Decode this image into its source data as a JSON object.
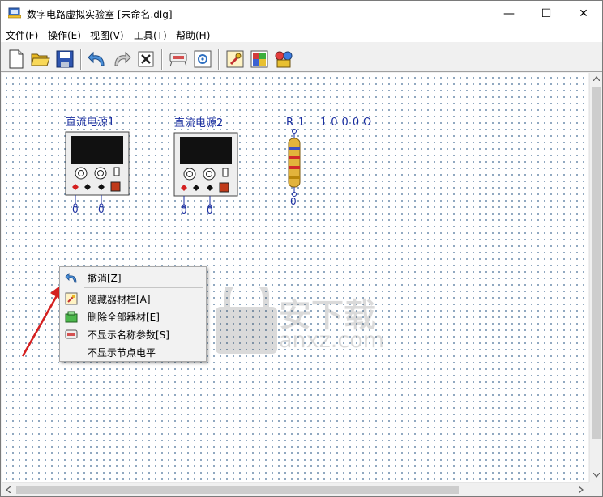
{
  "window": {
    "title": "数字电路虚拟实验室 [未命名.dlg]",
    "minimize_glyph": "—",
    "maximize_glyph": "☐",
    "close_glyph": "✕"
  },
  "menu": [
    "文件(F)",
    "操作(E)",
    "视图(V)",
    "工具(T)",
    "帮助(H)"
  ],
  "toolbar": {
    "buttons": [
      "new-file-icon",
      "open-folder-icon",
      "save-icon",
      "undo-icon",
      "redo-icon",
      "delete-icon",
      "component-icon",
      "settings-icon",
      "tool-wrench-icon",
      "palette-icon",
      "parts-library-icon"
    ]
  },
  "components": {
    "psu1": {
      "label": "直流电源1",
      "node_left": "0",
      "node_right": "0"
    },
    "psu2": {
      "label": "直流电源2",
      "node_left": "0",
      "node_right": "0"
    },
    "resistor": {
      "name": "R1",
      "value": "1000Ω",
      "node": "0"
    }
  },
  "context_menu": {
    "items": [
      {
        "label": "撤消[Z]",
        "icon": "undo-icon"
      },
      {
        "label": "隐藏器材栏[A]",
        "icon": "hide-toolbar-icon"
      },
      {
        "label": "删除全部器材[E]",
        "icon": "delete-all-icon"
      },
      {
        "label": "不显示名称参数[S]",
        "icon": "hide-params-icon"
      },
      {
        "label": "不显示节点电平",
        "icon": ""
      }
    ]
  },
  "watermark": {
    "brand": "安下载",
    "domain": "anxz.com"
  },
  "colors": {
    "label_blue": "#1a2ea0",
    "arrow_red": "#d42020",
    "grid_dot": "#7f9bb6"
  }
}
